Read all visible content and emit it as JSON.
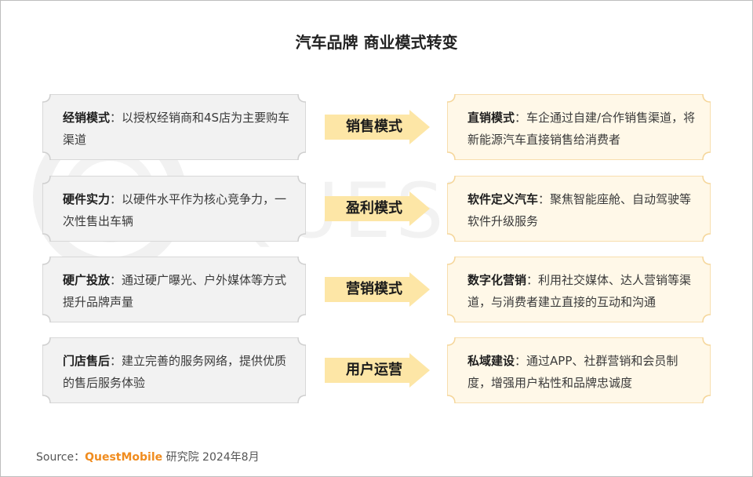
{
  "title": "汽车品牌 商业模式转变",
  "watermark": "QUEST MOBILE",
  "colors": {
    "left_fill": "#f2f2f2",
    "left_border": "#cfcfcf",
    "right_fill": "#fff8e8",
    "right_border": "#f5d69a",
    "arrow": "#fde6a6",
    "brand": "#f08c1f"
  },
  "rows": [
    {
      "left_term": "经销模式",
      "left_desc": "：以授权经销商和4S店为主要购车渠道",
      "arrow": "销售模式",
      "right_term": "直销模式",
      "right_desc": "：车企通过自建/合作销售渠道，将新能源汽车直接销售给消费者"
    },
    {
      "left_term": "硬件实力",
      "left_desc": "：以硬件水平作为核心竞争力，一次性售出车辆",
      "arrow": "盈利模式",
      "right_term": "软件定义汽车",
      "right_desc": "：聚焦智能座舱、自动驾驶等软件升级服务"
    },
    {
      "left_term": "硬广投放",
      "left_desc": "：通过硬广曝光、户外媒体等方式提升品牌声量",
      "arrow": "营销模式",
      "right_term": "数字化营销",
      "right_desc": "：利用社交媒体、达人营销等渠道，与消费者建立直接的互动和沟通"
    },
    {
      "left_term": "门店售后",
      "left_desc": "：建立完善的服务网络，提供优质的售后服务体验",
      "arrow": "用户运营",
      "right_term": "私域建设",
      "right_desc": "：通过APP、社群营销和会员制度，增强用户粘性和品牌忠诚度"
    }
  ],
  "source": {
    "prefix": "Source：",
    "brand": "QuestMobile",
    "suffix": " 研究院 2024年8月"
  }
}
